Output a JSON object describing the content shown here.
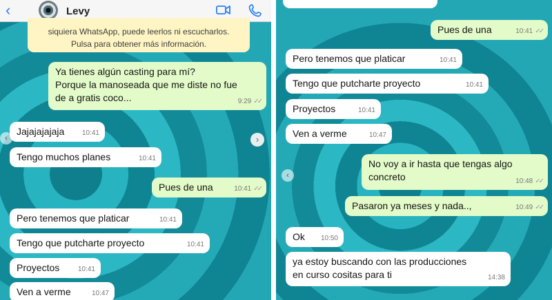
{
  "header": {
    "contact_name": "Levy",
    "back_icon": "chevron-left-icon",
    "video_icon": "video-camera-icon",
    "phone_icon": "phone-icon"
  },
  "notice": {
    "text": "siquiera WhatsApp, puede leerlos ni escucharlos.\nPulsa para obtener más información."
  },
  "left_messages": [
    {
      "dir": "out",
      "text": "Ya tienes algún casting para mí?\nPorque la manoseada que me diste no fue\nde a gratis coco...",
      "time": "9:29",
      "ticks": "✓✓"
    },
    {
      "dir": "in",
      "text": "Jajajajajaja",
      "time": "10:41"
    },
    {
      "dir": "in",
      "text": "Tengo muchos planes",
      "time": "10:41"
    },
    {
      "dir": "out",
      "text": "Pues de una",
      "time": "10:41",
      "ticks": "✓✓"
    },
    {
      "dir": "in",
      "text": "Pero tenemos que platicar",
      "time": "10:41"
    },
    {
      "dir": "in",
      "text": "Tengo que putcharte proyecto",
      "time": "10:41"
    },
    {
      "dir": "in",
      "text": "Proyectos",
      "time": "10:41"
    },
    {
      "dir": "in",
      "text": "Ven a verme",
      "time": "10:47"
    }
  ],
  "right_messages": [
    {
      "dir": "out",
      "text": "Pues de una",
      "time": "10:41",
      "ticks": "✓✓"
    },
    {
      "dir": "in",
      "text": "Pero tenemos que platicar",
      "time": "10:41"
    },
    {
      "dir": "in",
      "text": "Tengo que putcharte proyecto",
      "time": "10:41"
    },
    {
      "dir": "in",
      "text": "Proyectos",
      "time": "10:41"
    },
    {
      "dir": "in",
      "text": "Ven a verme",
      "time": "10:47"
    },
    {
      "dir": "out",
      "text": "No voy a ir hasta que tengas algo\nconcreto",
      "time": "10:48",
      "ticks": "✓✓"
    },
    {
      "dir": "out",
      "text": "Pasaron ya meses y nada..,",
      "time": "10:49",
      "ticks": "✓✓"
    },
    {
      "dir": "in",
      "text": "Ok",
      "time": "10:50"
    },
    {
      "dir": "in",
      "text": "ya estoy buscando con las producciones\nen curso cositas para ti",
      "time": "14:38"
    }
  ],
  "colors": {
    "incoming": "#ffffff",
    "outgoing": "#e3fbc9",
    "background": "#1f9fad",
    "accent": "#2a7ff2",
    "notice": "#fff5c4"
  }
}
